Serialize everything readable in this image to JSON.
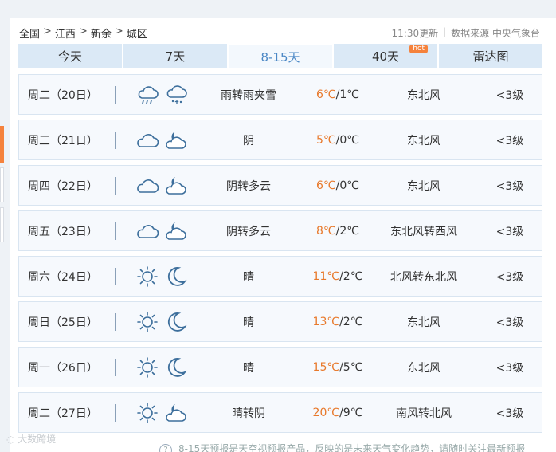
{
  "breadcrumb": {
    "items": [
      "全国",
      "江西",
      "新余",
      "城区"
    ],
    "separator": ">"
  },
  "meta": {
    "updated": "11:30更新",
    "source": "数据来源 中央气象台"
  },
  "tabs": [
    {
      "label": "今天",
      "active": false
    },
    {
      "label": "7天",
      "active": false
    },
    {
      "label": "8-15天",
      "active": true
    },
    {
      "label": "40天",
      "active": false,
      "badge": "hot"
    },
    {
      "label": "雷达图",
      "active": false
    }
  ],
  "forecast": [
    {
      "day": "周二（20日）",
      "icons": [
        "rain-icon",
        "sleet-icon"
      ],
      "desc": "雨转雨夹雪",
      "high": "6℃",
      "low": "/1℃",
      "wind": "东北风",
      "level": "<3级"
    },
    {
      "day": "周三（21日）",
      "icons": [
        "cloudy-icon",
        "moon-cloud-icon"
      ],
      "desc": "阴",
      "high": "5℃",
      "low": "/0℃",
      "wind": "东北风",
      "level": "<3级"
    },
    {
      "day": "周四（22日）",
      "icons": [
        "cloudy-icon",
        "moon-cloud-icon"
      ],
      "desc": "阴转多云",
      "high": "6℃",
      "low": "/0℃",
      "wind": "东北风",
      "level": "<3级"
    },
    {
      "day": "周五（23日）",
      "icons": [
        "cloudy-icon",
        "moon-cloud-icon"
      ],
      "desc": "阴转多云",
      "high": "8℃",
      "low": "/2℃",
      "wind": "东北风转西风",
      "level": "<3级"
    },
    {
      "day": "周六（24日）",
      "icons": [
        "sun-icon",
        "moon-icon"
      ],
      "desc": "晴",
      "high": "11℃",
      "low": "/2℃",
      "wind": "北风转东北风",
      "level": "<3级"
    },
    {
      "day": "周日（25日）",
      "icons": [
        "sun-icon",
        "moon-icon"
      ],
      "desc": "晴",
      "high": "13℃",
      "low": "/2℃",
      "wind": "东北风",
      "level": "<3级"
    },
    {
      "day": "周一（26日）",
      "icons": [
        "sun-icon",
        "moon-icon"
      ],
      "desc": "晴",
      "high": "15℃",
      "low": "/5℃",
      "wind": "东北风",
      "level": "<3级"
    },
    {
      "day": "周二（27日）",
      "icons": [
        "sun-icon",
        "moon-cloud-icon"
      ],
      "desc": "晴转阴",
      "high": "20℃",
      "low": "/9℃",
      "wind": "南风转北风",
      "level": "<3级"
    }
  ],
  "watermark": "大数跨境",
  "footnote": "8-15天预报是天空视预报产品，反映的是未来天气变化趋势，请随时关注最新预报",
  "colors": {
    "accent": "#4a87c5",
    "high_temp": "#e8792b",
    "tab_bg": "#dbe9f6",
    "row_bg": "#f6f9fd",
    "icon_stroke": "#3d6f9c",
    "hot_badge": "#f5823c"
  }
}
